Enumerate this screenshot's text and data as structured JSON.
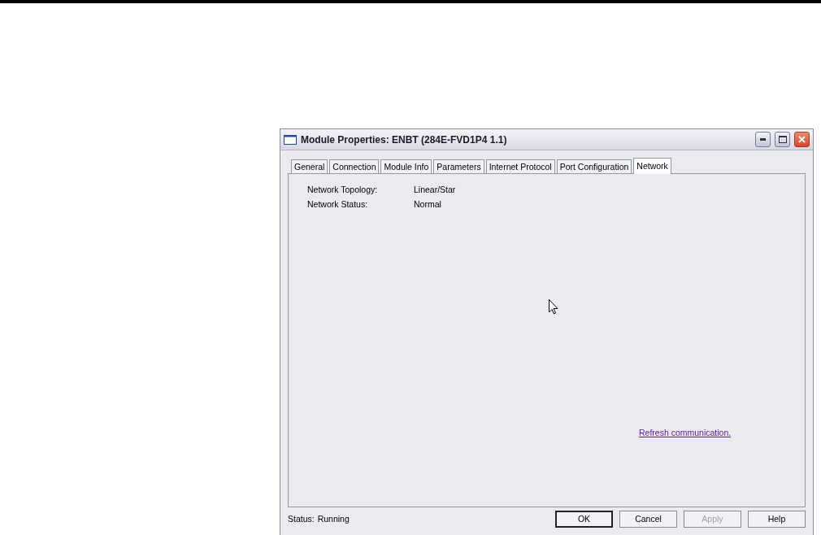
{
  "window": {
    "title": "Module Properties: ENBT (284E-FVD1P4 1.1)"
  },
  "tabs": [
    {
      "label": "General",
      "selected": false
    },
    {
      "label": "Connection",
      "selected": false
    },
    {
      "label": "Module Info",
      "selected": false
    },
    {
      "label": "Parameters",
      "selected": false
    },
    {
      "label": "Internet Protocol",
      "selected": false
    },
    {
      "label": "Port Configuration",
      "selected": false
    },
    {
      "label": "Network",
      "selected": true
    }
  ],
  "fields": [
    {
      "label": "Network Topology:",
      "value": "Linear/Star"
    },
    {
      "label": "Network Status:",
      "value": "Normal"
    }
  ],
  "link": "Refresh communication.",
  "status": {
    "label": "Status:",
    "value": "Running"
  },
  "buttons": [
    {
      "label": "OK",
      "default": true,
      "disabled": false
    },
    {
      "label": "Cancel",
      "default": false,
      "disabled": false
    },
    {
      "label": "Apply",
      "default": false,
      "disabled": true
    },
    {
      "label": "Help",
      "default": false,
      "disabled": false
    }
  ]
}
